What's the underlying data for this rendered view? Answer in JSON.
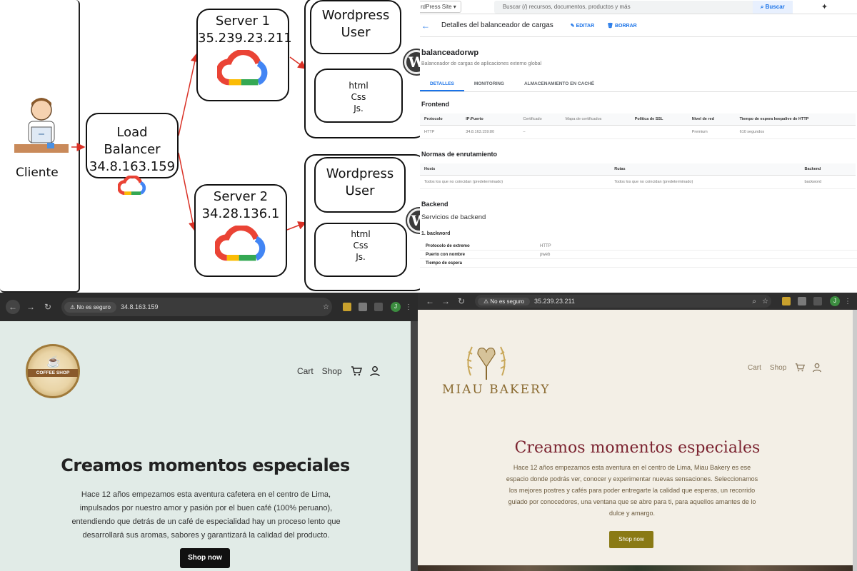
{
  "diagram": {
    "cliente_label": "Cliente",
    "load_balancer": {
      "title": "Load Balancer",
      "ip": "34.8.163.159"
    },
    "server1": {
      "title": "Server 1",
      "ip": "35.239.23.211"
    },
    "server2": {
      "title": "Server 2",
      "ip": "34.28.136.1"
    },
    "wordpress_user_1": {
      "line1": "Wordpress",
      "line2": "User"
    },
    "wordpress_user_2": {
      "line1": "Wordpress",
      "line2": "User"
    },
    "code_box_1": {
      "line1": "html",
      "line2": "Css",
      "line3": "Js."
    },
    "code_box_2": {
      "line1": "html",
      "line2": "Css",
      "line3": "Js."
    },
    "colors": {
      "arrow": "#d93025",
      "border": "#111111"
    }
  },
  "gcp": {
    "project_selector": "rdPress Site",
    "search_placeholder": "Buscar (/) recursos, documentos, productos y más",
    "search_button": "Buscar",
    "page_title": "Detalles del balanceador de cargas",
    "edit_label": "EDITAR",
    "delete_label": "BORRAR",
    "lb_name": "balanceadorwp",
    "lb_description": "Balanceador de cargas de aplicaciones externo global",
    "tabs": [
      "DETALLES",
      "MONITORING",
      "ALMACENAMIENTO EN CACHÉ"
    ],
    "frontend": {
      "heading": "Frontend",
      "columns": [
        "Protocolo",
        "IP:Puerto",
        "Certificado",
        "Mapa de certificados",
        "Política de SSL",
        "Nivel de red",
        "Tiempo de espera keepalive de HTTP"
      ],
      "row": [
        "HTTP",
        "34.8.163.159:80",
        "–",
        "",
        "",
        "Premium",
        "610 segundos"
      ]
    },
    "routing": {
      "heading": "Normas de enrutamiento",
      "columns": [
        "Hosts",
        "Rutas",
        "Backend"
      ],
      "row": [
        "Todos los que no coincidan (predeterminado)",
        "Todos los que no coincidan (predeterminado)",
        "backword"
      ]
    },
    "backend": {
      "heading": "Backend",
      "services_label": "Servicios de backend",
      "service_name": "1. backword",
      "props": [
        {
          "k": "Protocolo de extremo",
          "v": "HTTP"
        },
        {
          "k": "Puerto con nombre",
          "v": "pweb"
        },
        {
          "k": "Tiempo de espera",
          "v": ""
        }
      ]
    },
    "colors": {
      "accent": "#1a73e8"
    }
  },
  "coffee_browser": {
    "insecure_label": "No es seguro",
    "url": "34.8.163.159",
    "profile_letter": "J"
  },
  "coffee_site": {
    "logo_text": "COFFEE SHOP",
    "nav_cart": "Cart",
    "nav_shop": "Shop",
    "hero_title": "Creamos momentos especiales",
    "hero_body": "Hace 12 años empezamos esta aventura cafetera en el centro de Lima, impulsados por nuestro amor y pasión por el buen café (100% peruano), entendiendo que detrás de un café de especialidad hay un proceso lento que desarrollará sus aromas, sabores y garantizará la calidad del producto.",
    "shop_button": "Shop now"
  },
  "bakery_browser": {
    "insecure_label": "No es seguro",
    "url": "35.239.23.211",
    "profile_letter": "J"
  },
  "bakery_site": {
    "brand_name": "MIAU BAKERY",
    "nav_cart": "Cart",
    "nav_shop": "Shop",
    "hero_title": "Creamos momentos especiales",
    "hero_body": "Hace 12 años empezamos esta aventura en el centro de Lima, Miau Bakery es ese espacio donde podrás ver, conocer y experimentar nuevas sensaciones. Seleccionamos los mejores postres y cafés para poder entregarte la calidad que esperas, un recorrido guiado por conocedores, una ventana que se abre para ti, para aquellos amantes de lo dulce y amargo.",
    "shop_button": "Shop now"
  }
}
